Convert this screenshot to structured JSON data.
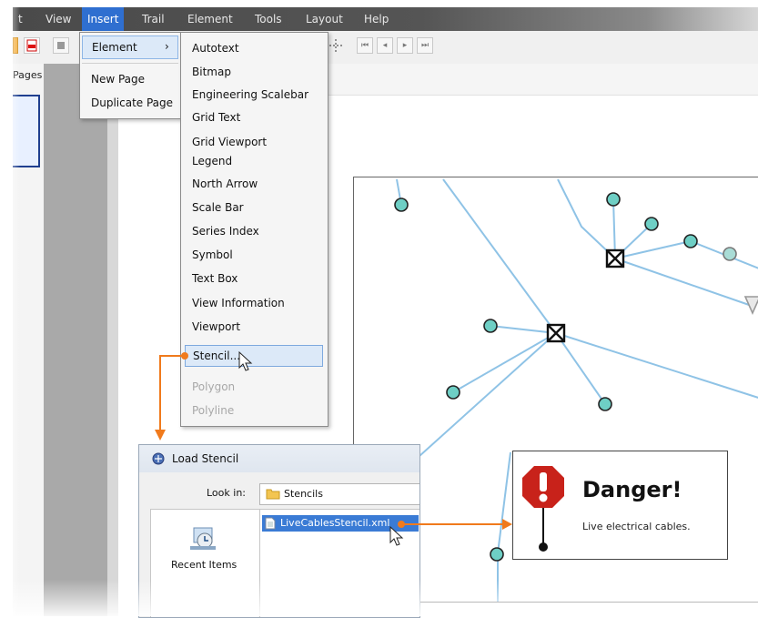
{
  "menubar": {
    "items": [
      "t",
      "View",
      "Insert",
      "Trail",
      "Element",
      "Tools",
      "Layout",
      "Help"
    ]
  },
  "panel": {
    "pages_label": "Pages"
  },
  "insert_menu": {
    "element_label": "Element",
    "submenu_arrow": "›",
    "new_page": "New Page",
    "duplicate_page": "Duplicate Page"
  },
  "element_submenu": {
    "items": [
      "Autotext",
      "Bitmap",
      "Engineering Scalebar",
      "Grid Text",
      "Grid Viewport",
      "Legend",
      "North Arrow",
      "Scale Bar",
      "Series Index",
      "Symbol",
      "Text Box",
      "View Information",
      "Viewport",
      "Stencil..."
    ],
    "disabled": [
      "Polygon",
      "Polyline"
    ]
  },
  "dialog": {
    "title": "Load Stencil",
    "look_in_label": "Look in:",
    "look_in_value": "Stencils",
    "recent_items": "Recent Items",
    "file_name": "LiveCablesStencil.xml"
  },
  "danger": {
    "title": "Danger!",
    "subtitle": "Live electrical cables."
  },
  "colors": {
    "menubar_bg": "#4a4a4a",
    "menu_highlight": "#2f6fd0",
    "cable_line": "#8fc3e6",
    "node_fill": "#6ecfc5",
    "callout_orange": "#f07a1c",
    "danger_red": "#c8221a"
  }
}
